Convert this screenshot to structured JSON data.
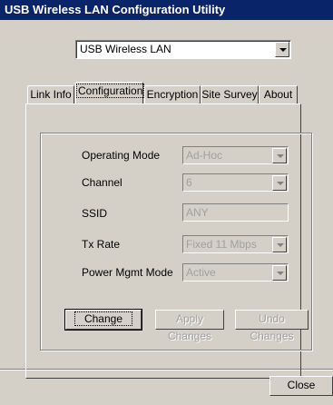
{
  "window": {
    "title": "USB Wireless LAN Configuration Utility"
  },
  "device": {
    "selected": "USB Wireless LAN"
  },
  "tabs": [
    {
      "label": "Link Info"
    },
    {
      "label": "Configuration"
    },
    {
      "label": "Encryption"
    },
    {
      "label": "Site Survey"
    },
    {
      "label": "About"
    }
  ],
  "config": {
    "operating_mode": {
      "label": "Operating Mode",
      "value": "Ad-Hoc"
    },
    "channel": {
      "label": "Channel",
      "value": "6"
    },
    "ssid": {
      "label": "SSID",
      "value": "ANY"
    },
    "tx_rate": {
      "label": "Tx Rate",
      "value": "Fixed 11 Mbps"
    },
    "power_mode": {
      "label": "Power Mgmt Mode",
      "value": "Active"
    }
  },
  "buttons": {
    "change": "Change",
    "apply": "Apply Changes",
    "undo": "Undo Changes",
    "close": "Close"
  }
}
